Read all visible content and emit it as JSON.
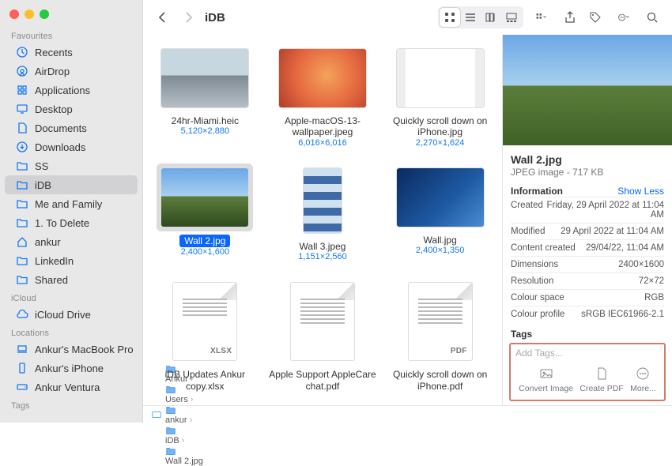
{
  "window_title": "iDB",
  "sidebar": {
    "groups": [
      {
        "title": "Favourites",
        "items": [
          {
            "icon": "clock",
            "label": "Recents"
          },
          {
            "icon": "airdrop",
            "label": "AirDrop"
          },
          {
            "icon": "apps",
            "label": "Applications"
          },
          {
            "icon": "desktop",
            "label": "Desktop"
          },
          {
            "icon": "doc",
            "label": "Documents"
          },
          {
            "icon": "download",
            "label": "Downloads"
          },
          {
            "icon": "folder",
            "label": "SS"
          },
          {
            "icon": "folder",
            "label": "iDB",
            "selected": true
          },
          {
            "icon": "folder",
            "label": "Me and Family"
          },
          {
            "icon": "folder",
            "label": "1. To Delete"
          },
          {
            "icon": "home",
            "label": "ankur"
          },
          {
            "icon": "folder",
            "label": "LinkedIn"
          },
          {
            "icon": "folder",
            "label": "Shared"
          }
        ]
      },
      {
        "title": "iCloud",
        "items": [
          {
            "icon": "cloud",
            "label": "iCloud Drive"
          }
        ]
      },
      {
        "title": "Locations",
        "items": [
          {
            "icon": "laptop",
            "label": "Ankur's MacBook Pro"
          },
          {
            "icon": "phone",
            "label": "Ankur's iPhone"
          },
          {
            "icon": "disk",
            "label": "Ankur Ventura"
          }
        ]
      },
      {
        "title": "Tags",
        "items": []
      }
    ]
  },
  "files": [
    {
      "name": "24hr-Miami.heic",
      "dim": "5,120×2,880",
      "thumb": "city"
    },
    {
      "name": "Apple-macOS-13-wallpaper.jpeg",
      "dim": "6,016×6,016",
      "thumb": "orange"
    },
    {
      "name": "Quickly scroll down on iPhone.jpg",
      "dim": "2,270×1,624",
      "thumb": "iphone"
    },
    {
      "name": "Wall 2.jpg",
      "dim": "2,400×1,600",
      "thumb": "meadow",
      "selected": true
    },
    {
      "name": "Wall 3.jpeg",
      "dim": "1,151×2,560",
      "thumb": "stripes",
      "tall": true
    },
    {
      "name": "Wall.jpg",
      "dim": "2,400×1,350",
      "thumb": "bluewave"
    },
    {
      "name": "iDB Updates Ankur copy.xlsx",
      "badge": "XLSX",
      "doc": true
    },
    {
      "name": "Apple Support AppleCare chat.pdf",
      "doc": true,
      "text": true
    },
    {
      "name": "Quickly scroll down on iPhone.pdf",
      "badge": "PDF",
      "doc": true,
      "text": true
    }
  ],
  "pathbar": [
    "Ankur",
    "Users",
    "ankur",
    "iDB",
    "Wall 2.jpg"
  ],
  "inspector": {
    "name": "Wall 2.jpg",
    "kind": "JPEG image - 717 KB",
    "info_header": "Information",
    "show_toggle": "Show Less",
    "rows": [
      {
        "k": "Created",
        "v": "Friday, 29 April 2022 at 11:04 AM"
      },
      {
        "k": "Modified",
        "v": "29 April 2022 at 11:04 AM"
      },
      {
        "k": "Content created",
        "v": "29/04/22, 11:04 AM"
      },
      {
        "k": "Dimensions",
        "v": "2400×1600"
      },
      {
        "k": "Resolution",
        "v": "72×72"
      },
      {
        "k": "Colour space",
        "v": "RGB"
      },
      {
        "k": "Colour profile",
        "v": "sRGB IEC61966-2.1"
      }
    ],
    "tags_header": "Tags",
    "tags_placeholder": "Add Tags...",
    "actions": [
      {
        "label": "Convert Image"
      },
      {
        "label": "Create PDF"
      },
      {
        "label": "More..."
      }
    ]
  }
}
